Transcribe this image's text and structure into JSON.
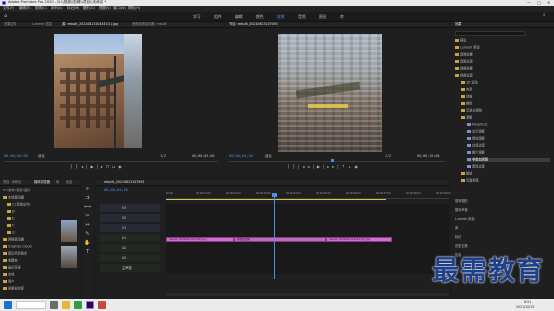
{
  "window": {
    "title": "Adobe Premiere Pro 2020 - D:\\\\视频\\\\剪辑\\\\项目\\\\未命名 *",
    "controls": [
      "—",
      "□",
      "✕"
    ]
  },
  "menu": [
    "文件(F)",
    "编辑(E)",
    "剪辑(C)",
    "序列(S)",
    "标记(M)",
    "图形(G)",
    "视图(V)",
    "窗口(W)",
    "帮助(H)"
  ],
  "workspaces": {
    "items": [
      "学习",
      "组件",
      "编辑",
      "颜色",
      "效果",
      "音频",
      "图形",
      "库"
    ],
    "active_index": 4
  },
  "source_panel": {
    "tabs": [
      "效果控件",
      "Lumetri 范围",
      "源: rebuilt_20210813104447(1).jpg",
      "音频剪辑混合器: rebuilt"
    ],
    "active_tab": 2,
    "timecode_left": "00;00;00;00",
    "fit": "适合",
    "ratio": "1/2",
    "timecode_right": "00;00;05;00"
  },
  "program_panel": {
    "tabs": [
      "节目: rebuilt_20210813107093"
    ],
    "active_tab": 0,
    "timecode_left": "00;00;04;20",
    "fit": "适合",
    "ratio": "1/2",
    "timecode_right": "00;00;10;00"
  },
  "effects_panel": {
    "tabs": [
      "效果"
    ],
    "tree": [
      {
        "label": "预设",
        "level": 0
      },
      {
        "label": "Lumetri 预设",
        "level": 0
      },
      {
        "label": "音频效果",
        "level": 0
      },
      {
        "label": "音频过渡",
        "level": 0
      },
      {
        "label": "视频效果",
        "level": 0
      },
      {
        "label": "视频过渡",
        "level": 0
      },
      {
        "label": "3D 运动",
        "level": 1
      },
      {
        "label": "内滑",
        "level": 1
      },
      {
        "label": "划像",
        "level": 1
      },
      {
        "label": "擦除",
        "level": 1
      },
      {
        "label": "沉浸式视频",
        "level": 1
      },
      {
        "label": "溶解",
        "level": 1
      },
      {
        "label": "MorphCut",
        "level": 2
      },
      {
        "label": "交叉溶解",
        "level": 2
      },
      {
        "label": "叠加溶解",
        "level": 2
      },
      {
        "label": "白场过渡",
        "level": 2
      },
      {
        "label": "胶片溶解",
        "level": 2
      },
      {
        "label": "非叠加溶解",
        "level": 2
      },
      {
        "label": "黑场过渡",
        "level": 2
      },
      {
        "label": "缩放",
        "level": 1
      },
      {
        "label": "页面剥落",
        "level": 1
      }
    ],
    "selected_index": 17,
    "bottom": [
      "基本图形",
      "基本声音",
      "Lumetri 颜色",
      "库",
      "标记",
      "历史记录",
      "信息"
    ]
  },
  "project_panel": {
    "tabs": [
      "项目: 未命名",
      "媒体浏览器",
      "库",
      "信息"
    ],
    "active_tab": 1,
    "path": "D:\\\\素材\\\\项目\\\\图片",
    "drives": [
      "本地驱动器",
      "C:(系统文件)",
      "D:",
      "E:",
      "F:",
      "G:",
      "网络驱动器",
      "Creative Cloud",
      "团队项目版本",
      "收藏夹",
      "最近目录",
      "本地",
      "用户",
      "剪辑素材库"
    ]
  },
  "timeline": {
    "tabs": [
      "rebuilt_20210813107093"
    ],
    "timecode": "00;00;04;20",
    "ruler": [
      "00;00",
      "00;00;01;00",
      "00;00;02;00",
      "00;00;03;00",
      "00;00;04;00",
      "00;00;05;00",
      "00;00;06;00",
      "00;00;07;00",
      "00;00;08;00",
      "00;00;09;00"
    ],
    "tracks": [
      "V3",
      "V2",
      "V1",
      "A1",
      "A2",
      "A3",
      "主声道"
    ],
    "clips": [
      {
        "label": "rebuilt_20210813107093.jpg"
      },
      {
        "label": "非叠加溶解"
      },
      {
        "label": "rebuilt_20210813104447(1).jpg"
      }
    ]
  },
  "watermark": "最需教育",
  "taskbar": {
    "time": "8:51",
    "date": "2021/10/15"
  }
}
